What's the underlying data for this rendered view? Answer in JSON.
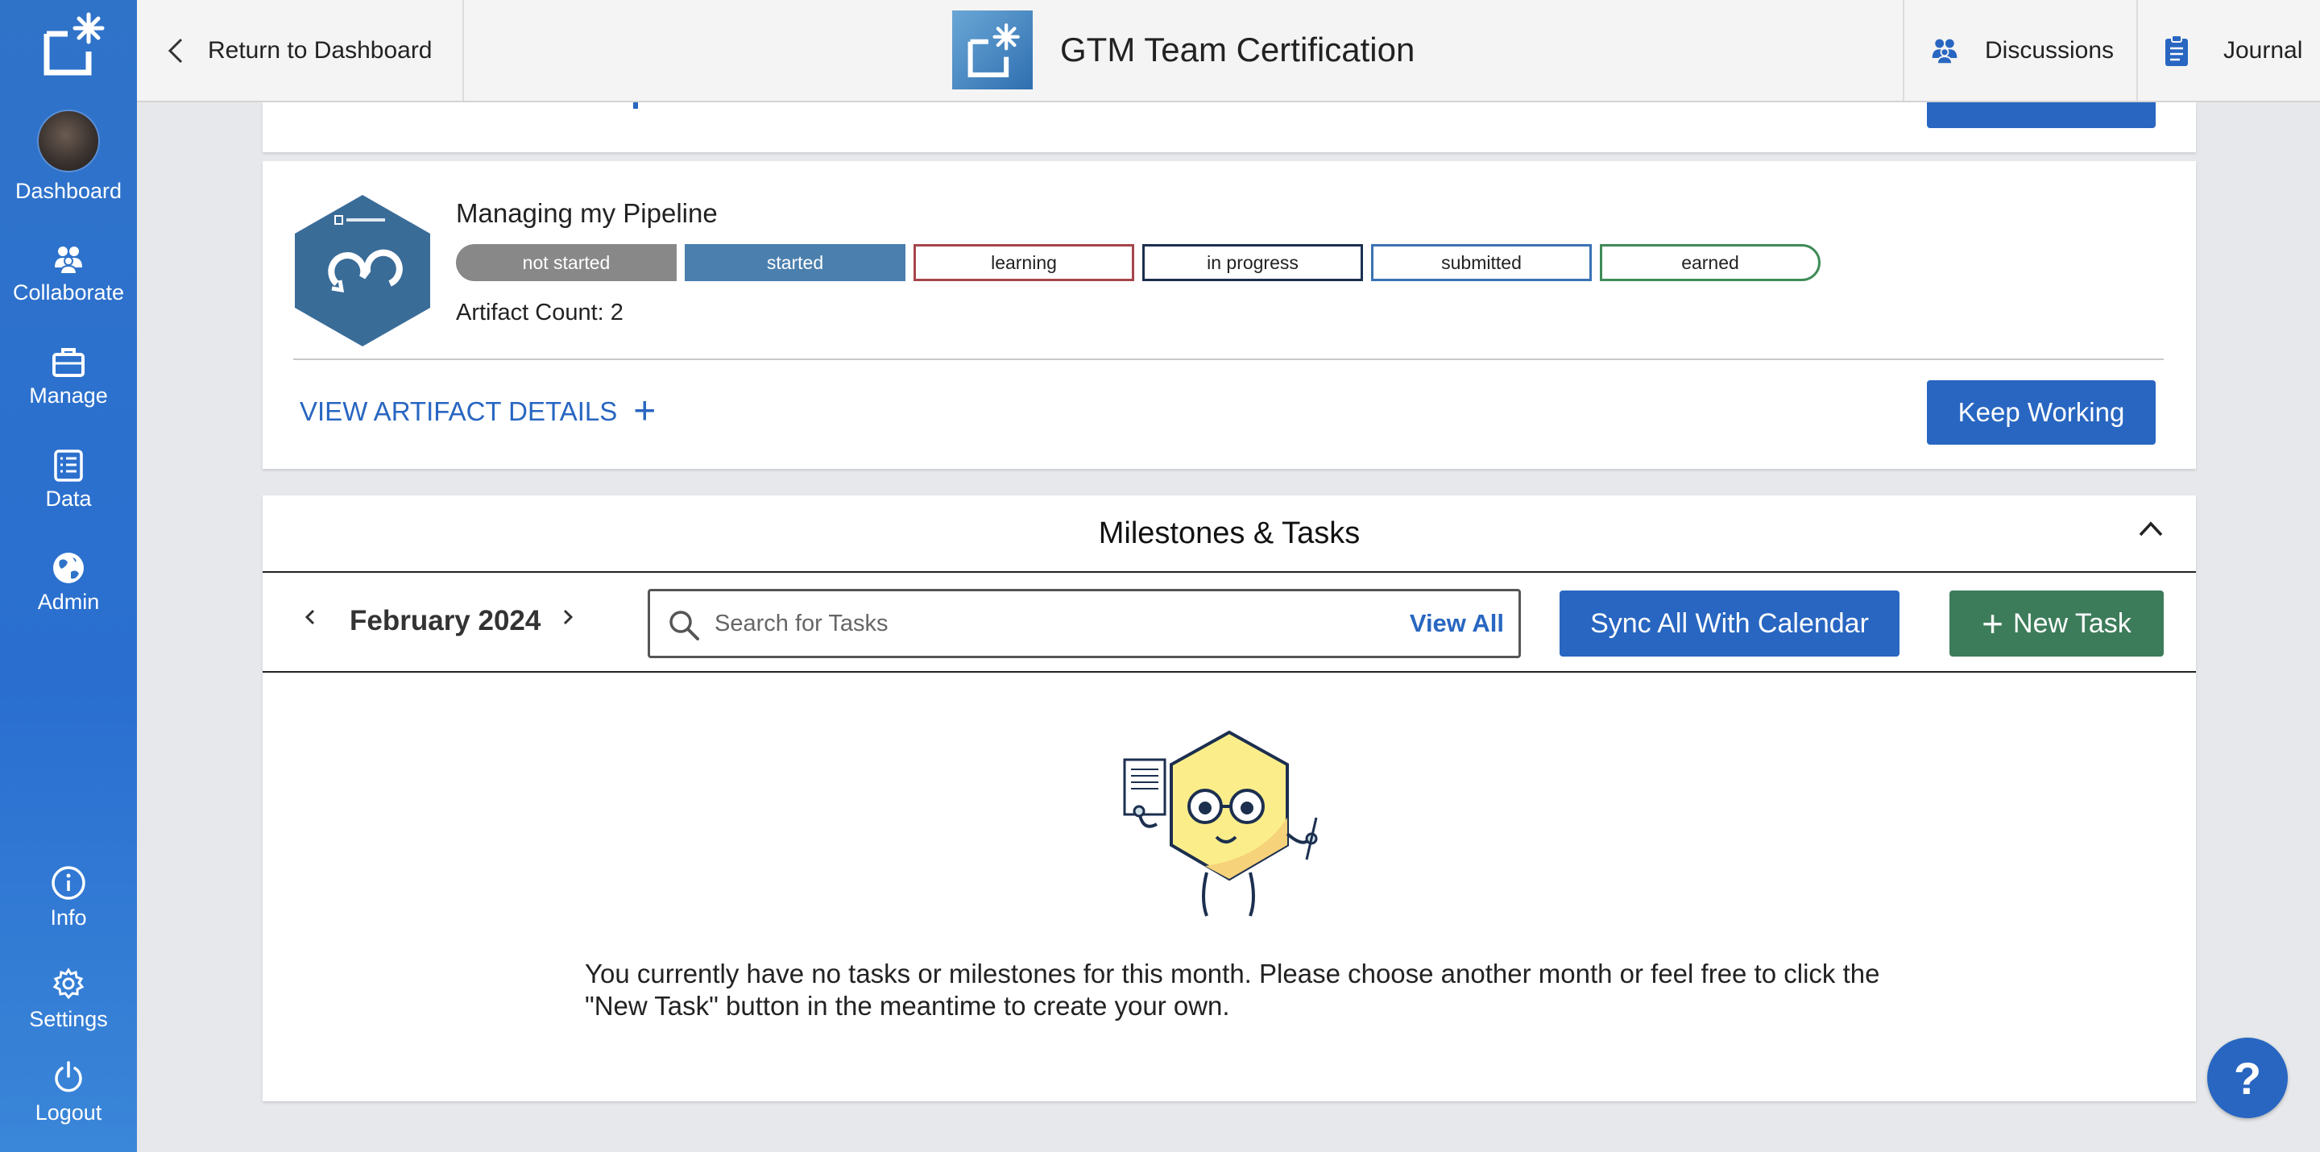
{
  "sidebar": {
    "items": [
      {
        "label": "Dashboard",
        "icon": "avatar"
      },
      {
        "label": "Collaborate",
        "icon": "people-icon"
      },
      {
        "label": "Manage",
        "icon": "briefcase-icon"
      },
      {
        "label": "Data",
        "icon": "clipboard-list-icon"
      },
      {
        "label": "Admin",
        "icon": "globe-icon"
      },
      {
        "label": "Info",
        "icon": "info-icon"
      },
      {
        "label": "Settings",
        "icon": "gear-icon"
      },
      {
        "label": "Logout",
        "icon": "power-icon"
      }
    ]
  },
  "header": {
    "back_label": "Return to Dashboard",
    "title": "GTM Team Certification",
    "discussions_label": "Discussions",
    "journal_label": "Journal"
  },
  "pipeline": {
    "title": "Managing my Pipeline",
    "statuses": [
      "not started",
      "started",
      "learning",
      "in progress",
      "submitted",
      "earned"
    ],
    "active_status": "started",
    "artifact_count": "Artifact Count: 2",
    "view_details": "VIEW ARTIFACT DETAILS",
    "keep_working": "Keep Working"
  },
  "milestones": {
    "title": "Milestones & Tasks",
    "month": "February 2024",
    "search_placeholder": "Search for Tasks",
    "view_all": "View All",
    "sync_label": "Sync All With Calendar",
    "new_task_label": "New Task",
    "empty_message": "You currently have no tasks or milestones for this month. Please choose another month or feel free to click the \"New Task\" button in the meantime to create your own."
  },
  "help": {
    "label": "?"
  },
  "colors": {
    "primary": "#2866c1",
    "success": "#3d7c5a",
    "sidebar": "#2f73c9"
  }
}
